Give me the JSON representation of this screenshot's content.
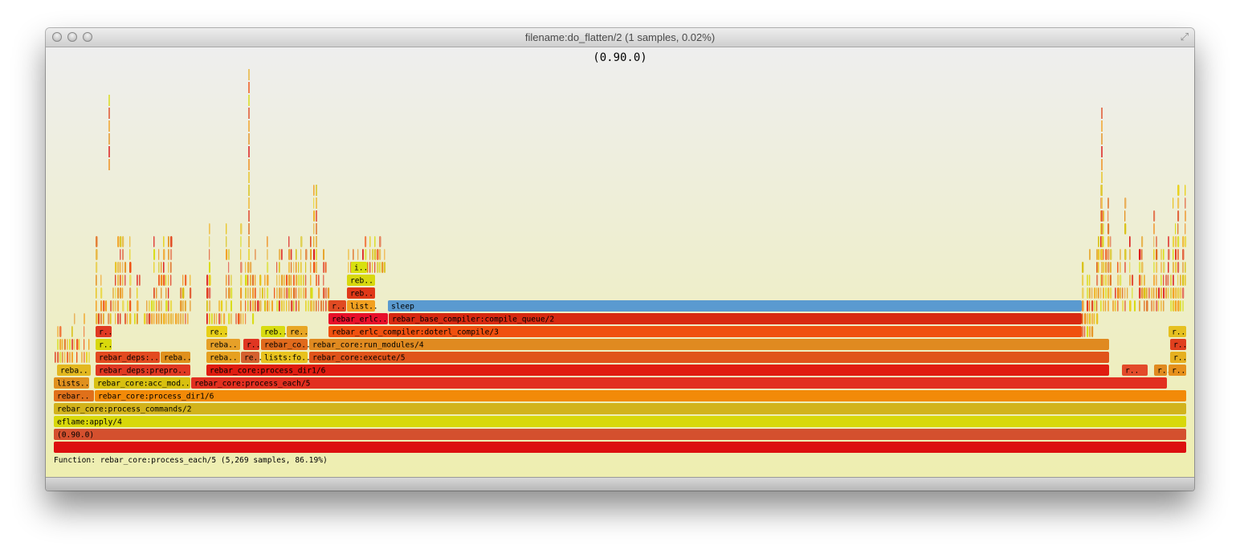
{
  "window": {
    "title": "filename:do_flatten/2 (1 samples, 0.02%)"
  },
  "chart_data": {
    "type": "flame",
    "title": "(0.90.0)",
    "frames": [
      {
        "depth": 0,
        "start": 0,
        "end": 1410,
        "label": "",
        "color": "#dc1010"
      },
      {
        "depth": 1,
        "start": 0,
        "end": 1410,
        "label": "(0.90.0)",
        "color": "#d4502e"
      },
      {
        "depth": 2,
        "start": 0,
        "end": 1410,
        "label": "eflame:apply/4",
        "color": "#d8d80a"
      },
      {
        "depth": 3,
        "start": 0,
        "end": 1410,
        "label": "rebar_core:process_commands/2",
        "color": "#d2b31c"
      },
      {
        "depth": 4,
        "start": 0,
        "end": 50,
        "label": "rebar..",
        "color": "#e0701a"
      },
      {
        "depth": 4,
        "start": 51,
        "end": 1410,
        "label": "rebar_core:process_dir1/6",
        "color": "#f28a08"
      },
      {
        "depth": 5,
        "start": 0,
        "end": 44,
        "label": "lists..",
        "color": "#e0901e"
      },
      {
        "depth": 5,
        "start": 50,
        "end": 170,
        "label": "rebar_core:acc_mod..",
        "color": "#d8c010"
      },
      {
        "depth": 5,
        "start": 171,
        "end": 1386,
        "label": "rebar_core:process_each/5",
        "color": "#e23020"
      },
      {
        "depth": 6,
        "start": 4,
        "end": 46,
        "label": "reba..",
        "color": "#e3b820"
      },
      {
        "depth": 6,
        "start": 52,
        "end": 170,
        "label": "rebar_deps:prepro..",
        "color": "#e03822"
      },
      {
        "depth": 6,
        "start": 190,
        "end": 1314,
        "label": "rebar_core:process_dir1/6",
        "color": "#e01c10"
      },
      {
        "depth": 6,
        "start": 1330,
        "end": 1362,
        "label": "r..",
        "color": "#e34a2a"
      },
      {
        "depth": 6,
        "start": 1370,
        "end": 1386,
        "label": "r..",
        "color": "#e08a20"
      },
      {
        "depth": 6,
        "start": 1388,
        "end": 1410,
        "label": "r..",
        "color": "#e6901c"
      },
      {
        "depth": 7,
        "start": 52,
        "end": 132,
        "label": "rebar_deps:..",
        "color": "#e34a20"
      },
      {
        "depth": 7,
        "start": 133,
        "end": 170,
        "label": "reba..",
        "color": "#e0901c"
      },
      {
        "depth": 7,
        "start": 190,
        "end": 232,
        "label": "reba..",
        "color": "#e6a020"
      },
      {
        "depth": 7,
        "start": 233,
        "end": 256,
        "label": "re..",
        "color": "#d4612e"
      },
      {
        "depth": 7,
        "start": 258,
        "end": 316,
        "label": "lists:fo..",
        "color": "#e8c21e"
      },
      {
        "depth": 7,
        "start": 318,
        "end": 1314,
        "label": "rebar_core:execute/5",
        "color": "#e0541a"
      },
      {
        "depth": 7,
        "start": 1390,
        "end": 1410,
        "label": "r..",
        "color": "#e6b020"
      },
      {
        "depth": 8,
        "start": 52,
        "end": 72,
        "label": "r..",
        "color": "#d8d80c"
      },
      {
        "depth": 8,
        "start": 190,
        "end": 232,
        "label": "reba..",
        "color": "#e6a028"
      },
      {
        "depth": 8,
        "start": 236,
        "end": 256,
        "label": "r..",
        "color": "#e03622"
      },
      {
        "depth": 8,
        "start": 258,
        "end": 316,
        "label": "rebar_co..",
        "color": "#e06a1c"
      },
      {
        "depth": 8,
        "start": 318,
        "end": 1314,
        "label": "rebar_core:run_modules/4",
        "color": "#e08a20"
      },
      {
        "depth": 8,
        "start": 1390,
        "end": 1410,
        "label": "r..",
        "color": "#e0401e"
      },
      {
        "depth": 9,
        "start": 52,
        "end": 72,
        "label": "r..",
        "color": "#e03a22"
      },
      {
        "depth": 9,
        "start": 190,
        "end": 216,
        "label": "re..",
        "color": "#e8d018"
      },
      {
        "depth": 9,
        "start": 258,
        "end": 288,
        "label": "reb..",
        "color": "#d8dc10"
      },
      {
        "depth": 9,
        "start": 290,
        "end": 316,
        "label": "re..",
        "color": "#e8a624"
      },
      {
        "depth": 9,
        "start": 342,
        "end": 1280,
        "label": "rebar_erlc_compiler:doterl_compile/3",
        "color": "#f0500f"
      },
      {
        "depth": 9,
        "start": 1388,
        "end": 1410,
        "label": "r..",
        "color": "#e6c020"
      },
      {
        "depth": 10,
        "start": 342,
        "end": 416,
        "label": "rebar_erlc..",
        "color": "#e8102a"
      },
      {
        "depth": 10,
        "start": 417,
        "end": 1280,
        "label": "rebar_base_compiler:compile_queue/2",
        "color": "#d82a10"
      },
      {
        "depth": 11,
        "start": 342,
        "end": 364,
        "label": "r..",
        "color": "#e04a22"
      },
      {
        "depth": 11,
        "start": 365,
        "end": 400,
        "label": "list..",
        "color": "#f2a020"
      },
      {
        "depth": 11,
        "start": 416,
        "end": 1280,
        "label": "sleep",
        "color": "#5a9ad0"
      },
      {
        "depth": 12,
        "start": 365,
        "end": 400,
        "label": "reb..",
        "color": "#e03818"
      },
      {
        "depth": 13,
        "start": 365,
        "end": 400,
        "label": "reb..",
        "color": "#d8d80e"
      },
      {
        "depth": 14,
        "start": 370,
        "end": 390,
        "label": "i..",
        "color": "#d8e00e"
      }
    ],
    "status": "Function: rebar_core:process_each/5 (5,269 samples, 86.19%)"
  }
}
